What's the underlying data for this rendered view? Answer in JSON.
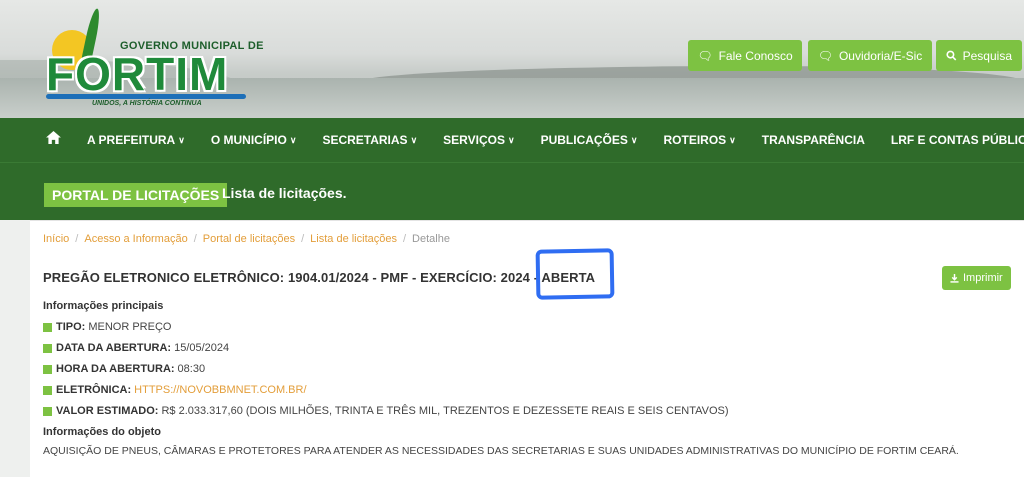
{
  "logo": {
    "gov_text": "GOVERNO MUNICIPAL DE",
    "name": "FORTIM",
    "tagline": "UNIDOS, A HISTÓRIA CONTINUA"
  },
  "top_buttons": [
    {
      "label": "Fale Conosco",
      "icon": "chat-icon"
    },
    {
      "label": "Ouvidoria/E-Sic",
      "icon": "chat-icon"
    },
    {
      "label": "Pesquisa",
      "icon": "search-icon"
    }
  ],
  "nav": {
    "items": [
      {
        "label": "A PREFEITURA",
        "dropdown": true
      },
      {
        "label": "O MUNICÍPIO",
        "dropdown": true
      },
      {
        "label": "SECRETARIAS",
        "dropdown": true
      },
      {
        "label": "SERVIÇOS",
        "dropdown": true
      },
      {
        "label": "PUBLICAÇÕES",
        "dropdown": true
      },
      {
        "label": "ROTEIROS",
        "dropdown": true
      },
      {
        "label": "TRANSPARÊNCIA",
        "dropdown": false
      },
      {
        "label": "LRF E CONTAS PÚBLICAS",
        "dropdown": true
      }
    ]
  },
  "banner": {
    "badge": "PORTAL DE LICITAÇÕES",
    "subtitle": "Lista de licitações."
  },
  "breadcrumb": [
    {
      "label": "Início",
      "link": true
    },
    {
      "label": "Acesso a Informação",
      "link": true
    },
    {
      "label": "Portal de licitações",
      "link": true
    },
    {
      "label": "Lista de licitações",
      "link": true
    },
    {
      "label": "Detalhe",
      "link": false
    }
  ],
  "detail": {
    "title": "PREGÃO ELETRONICO ELETRÔNICO: 1904.01/2024 - PMF - EXERCÍCIO: 2024 - ABERTA",
    "print_label": "Imprimir",
    "main_info_label": "Informações principais",
    "rows": [
      {
        "key": "TIPO:",
        "value": "MENOR PREÇO",
        "link": false
      },
      {
        "key": "DATA DA ABERTURA:",
        "value": "15/05/2024",
        "link": false
      },
      {
        "key": "HORA DA ABERTURA:",
        "value": "08:30",
        "link": false
      },
      {
        "key": "ELETRÔNICA:",
        "value": "HTTPS://NOVOBBMNET.COM.BR/",
        "link": true
      },
      {
        "key": "VALOR ESTIMADO:",
        "value": "R$ 2.033.317,60 (DOIS MILHÕES, TRINTA E TRÊS MIL, TREZENTOS E DEZESSETE REAIS E SEIS CENTAVOS)",
        "link": false
      }
    ],
    "object_label": "Informações do objeto",
    "object_text": "AQUISIÇÃO DE PNEUS, CÂMARAS E PROTETORES PARA ATENDER AS NECESSIDADES DAS SECRETARIAS E SUAS UNIDADES ADMINISTRATIVAS DO MUNICÍPIO DE FORTIM  CEARÁ."
  },
  "colors": {
    "nav_green": "#2f6b2a",
    "accent_green": "#7dc242",
    "link_orange": "#e39e3a",
    "annotation_blue": "#2f6df2"
  }
}
